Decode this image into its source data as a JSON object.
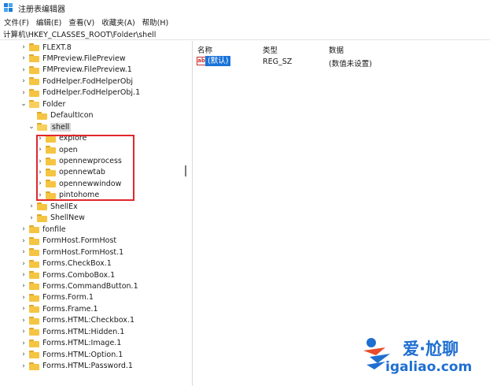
{
  "window": {
    "title": "注册表编辑器"
  },
  "menu": [
    "文件(F)",
    "编辑(E)",
    "查看(V)",
    "收藏夹(A)",
    "帮助(H)"
  ],
  "address": "计算机\\HKEY_CLASSES_ROOT\\Folder\\shell",
  "tree": [
    {
      "label": "FLEXT.8",
      "expander": "›",
      "indent": 0,
      "icon": "folder-closed"
    },
    {
      "label": "FMPreview.FilePreview",
      "expander": "›",
      "indent": 0,
      "icon": "folder-closed"
    },
    {
      "label": "FMPreview.FilePreview.1",
      "expander": "›",
      "indent": 0,
      "icon": "folder-closed"
    },
    {
      "label": "FodHelper.FodHelperObj",
      "expander": "›",
      "indent": 0,
      "icon": "folder-closed"
    },
    {
      "label": "FodHelper.FodHelperObj.1",
      "expander": "›",
      "indent": 0,
      "icon": "folder-closed"
    },
    {
      "label": "Folder",
      "expander": "⌄",
      "indent": 0,
      "icon": "folder-open"
    },
    {
      "label": "DefaultIcon",
      "expander": "",
      "indent": 1,
      "icon": "folder-closed"
    },
    {
      "label": "shell",
      "expander": "⌄",
      "indent": 1,
      "icon": "folder-open",
      "selected": true
    },
    {
      "label": "explore",
      "expander": "›",
      "indent": 2,
      "icon": "folder-closed"
    },
    {
      "label": "open",
      "expander": "›",
      "indent": 2,
      "icon": "folder-closed"
    },
    {
      "label": "opennewprocess",
      "expander": "›",
      "indent": 2,
      "icon": "folder-closed"
    },
    {
      "label": "opennewtab",
      "expander": "›",
      "indent": 2,
      "icon": "folder-closed"
    },
    {
      "label": "opennewwindow",
      "expander": "›",
      "indent": 2,
      "icon": "folder-closed"
    },
    {
      "label": "pintohome",
      "expander": "›",
      "indent": 2,
      "icon": "folder-closed"
    },
    {
      "label": "ShellEx",
      "expander": "›",
      "indent": 1,
      "icon": "folder-closed"
    },
    {
      "label": "ShellNew",
      "expander": "›",
      "indent": 1,
      "icon": "folder-closed"
    },
    {
      "label": "fonfile",
      "expander": "›",
      "indent": 0,
      "icon": "folder-closed"
    },
    {
      "label": "FormHost.FormHost",
      "expander": "›",
      "indent": 0,
      "icon": "folder-closed"
    },
    {
      "label": "FormHost.FormHost.1",
      "expander": "›",
      "indent": 0,
      "icon": "folder-closed"
    },
    {
      "label": "Forms.CheckBox.1",
      "expander": "›",
      "indent": 0,
      "icon": "folder-closed"
    },
    {
      "label": "Forms.ComboBox.1",
      "expander": "›",
      "indent": 0,
      "icon": "folder-closed"
    },
    {
      "label": "Forms.CommandButton.1",
      "expander": "›",
      "indent": 0,
      "icon": "folder-closed"
    },
    {
      "label": "Forms.Form.1",
      "expander": "›",
      "indent": 0,
      "icon": "folder-closed"
    },
    {
      "label": "Forms.Frame.1",
      "expander": "›",
      "indent": 0,
      "icon": "folder-closed"
    },
    {
      "label": "Forms.HTML:Checkbox.1",
      "expander": "›",
      "indent": 0,
      "icon": "folder-closed"
    },
    {
      "label": "Forms.HTML:Hidden.1",
      "expander": "›",
      "indent": 0,
      "icon": "folder-closed"
    },
    {
      "label": "Forms.HTML:Image.1",
      "expander": "›",
      "indent": 0,
      "icon": "folder-closed"
    },
    {
      "label": "Forms.HTML:Option.1",
      "expander": "›",
      "indent": 0,
      "icon": "folder-closed"
    },
    {
      "label": "Forms.HTML:Password.1",
      "expander": "›",
      "indent": 0,
      "icon": "folder-closed"
    }
  ],
  "columns": {
    "name": "名称",
    "type": "类型",
    "data": "数据"
  },
  "values": [
    {
      "icon": "ab",
      "name": "(默认)",
      "type": "REG_SZ",
      "data": "(数值未设置)"
    }
  ],
  "watermark": {
    "line1": "爱·尬聊",
    "line2": "igaliao.com"
  },
  "colors": {
    "selection": "#1a73d9",
    "highlight_box": "#e0262d",
    "folder": "#f5c542",
    "watermark": "#1f6fd1"
  }
}
